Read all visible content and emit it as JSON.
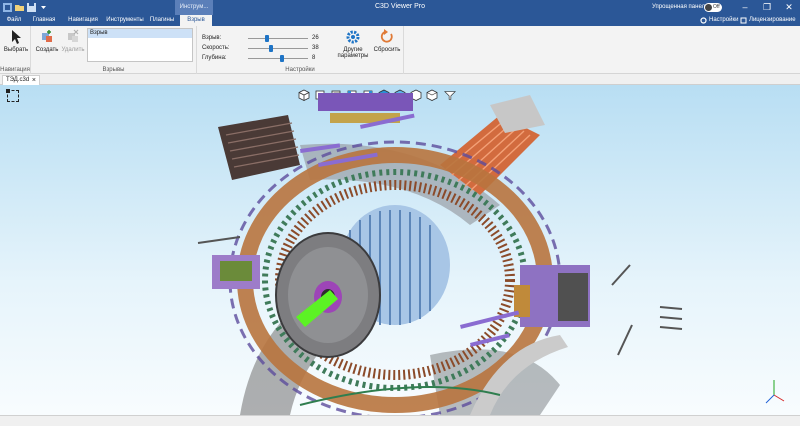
{
  "app": {
    "title": "C3D Viewer Pro"
  },
  "titlebar": {
    "context_tab": "Инструм...",
    "simplified_label": "Упрощенная панель",
    "toggle_state": "Off"
  },
  "tabs": [
    {
      "label": "Файл",
      "active": false
    },
    {
      "label": "Главная",
      "active": false
    },
    {
      "label": "Навигация",
      "active": false
    },
    {
      "label": "Инструменты",
      "active": false
    },
    {
      "label": "Плагины",
      "active": false
    },
    {
      "label": "Взрыв",
      "active": true
    }
  ],
  "tabs_right": {
    "settings": "Настройки",
    "licensing": "Лицензирование"
  },
  "ribbon": {
    "navigation": {
      "select_label": "Выбрать",
      "group_label": "Навигация"
    },
    "schemes": {
      "create_label": "Создать",
      "delete_label": "Удалить",
      "list_item": "Взрыв",
      "group_label": "Взрывы"
    },
    "settings": {
      "group_label": "Настройки",
      "sliders": [
        {
          "label": "Взрыв:",
          "value": "26",
          "fraction": 0.3
        },
        {
          "label": "Скорость:",
          "value": "38",
          "fraction": 0.38
        },
        {
          "label": "Глубина:",
          "value": "8",
          "fraction": 0.58
        }
      ],
      "other_params_line1": "Другие",
      "other_params_line2": "параметры",
      "reset_label": "Сбросить"
    }
  },
  "document": {
    "tab_label": "ТЭД.c3d"
  },
  "colors": {
    "accent": "#2b5797",
    "ribbon_bg": "#f3f3f3",
    "slider": "#1e74c6"
  }
}
